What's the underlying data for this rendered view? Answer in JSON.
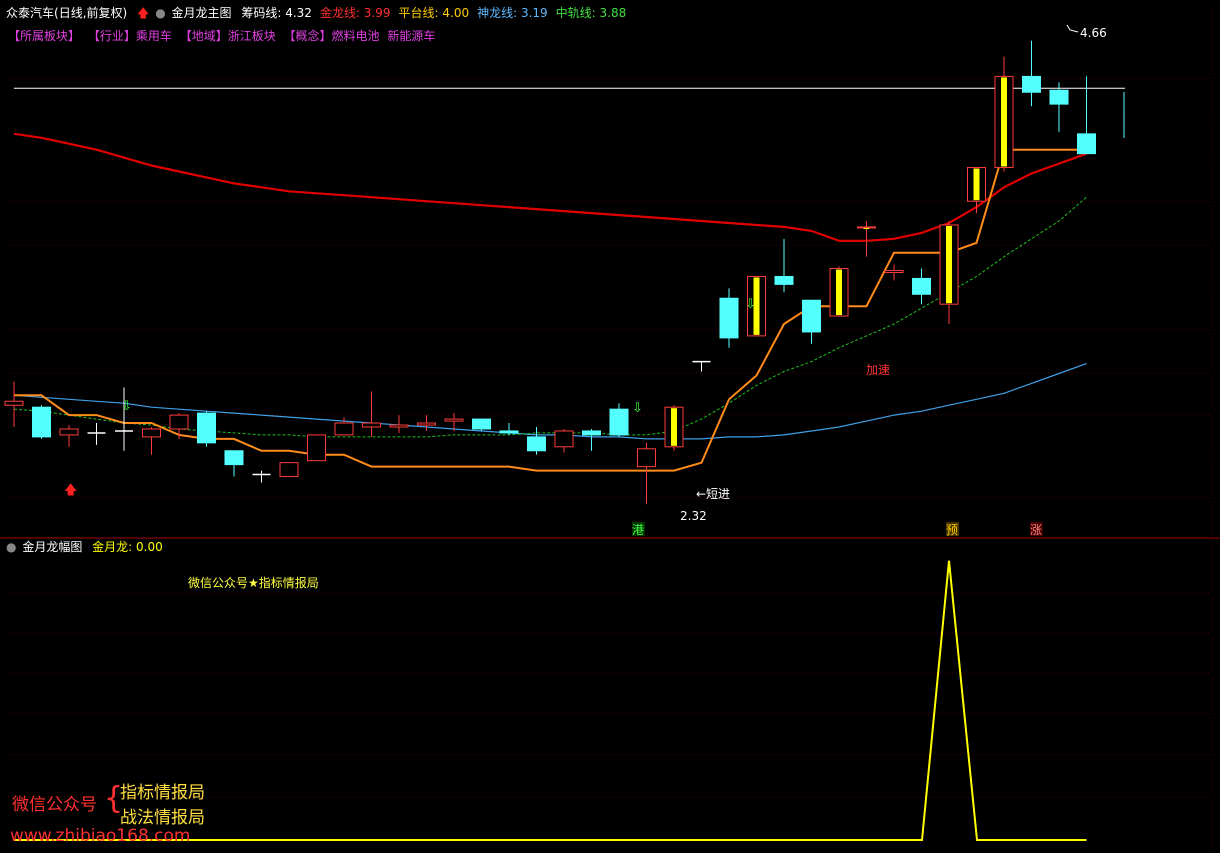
{
  "header": {
    "stock": "众泰汽车",
    "period": "(日线,前复权)",
    "indicator": "金月龙主图",
    "values": [
      {
        "label": "筹码线:",
        "value": "4.32",
        "color": "#ffffff"
      },
      {
        "label": "金龙线:",
        "value": "3.99",
        "color": "#ff3030"
      },
      {
        "label": "平台线:",
        "value": "4.00",
        "color": "#ffcc00"
      },
      {
        "label": "神龙线:",
        "value": "3.19",
        "color": "#5fb8ff"
      },
      {
        "label": "中轨线:",
        "value": "3.88",
        "color": "#40e040"
      }
    ]
  },
  "boards": [
    "【所属板块】",
    "【行业】乘用车",
    "【地域】浙江板块",
    "【概念】燃料电池",
    "新能源车"
  ],
  "lower_header": {
    "title": "金月龙幅图",
    "label": "金月龙:",
    "value": "0.00"
  },
  "watermark": {
    "top_text": "微信公众号★指标情报局",
    "left": "微信公众号",
    "line1": "指标情报局",
    "line2": "战法情报局",
    "url": "www.zhibiao168.com"
  },
  "annotations": {
    "high": "4.66",
    "low": "2.32",
    "entry": "←短进",
    "accel": "加速",
    "tag_gang": "港",
    "tag_yu": "预",
    "tag_zhang": "涨"
  },
  "colors": {
    "up": "#ff3c3c",
    "down": "#54ffff",
    "gold": "#ffff00",
    "ma_red": "#e00000",
    "platform": "#ff8c1a",
    "blue": "#3fa0e8",
    "mid": "#20c020"
  },
  "chart_data": {
    "type": "candlestick",
    "price_range": [
      2.2,
      4.8
    ],
    "candles": [
      {
        "o": 2.83,
        "h": 2.95,
        "l": 2.72,
        "c": 2.85,
        "t": "u"
      },
      {
        "o": 2.82,
        "h": 2.83,
        "l": 2.66,
        "c": 2.67,
        "t": "d"
      },
      {
        "o": 2.68,
        "h": 2.73,
        "l": 2.62,
        "c": 2.71,
        "t": "u"
      },
      {
        "o": 2.69,
        "h": 2.74,
        "l": 2.63,
        "c": 2.69,
        "t": "n"
      },
      {
        "o": 2.69,
        "h": 2.92,
        "l": 2.6,
        "c": 2.7,
        "t": "n"
      },
      {
        "o": 2.67,
        "h": 2.72,
        "l": 2.58,
        "c": 2.71,
        "t": "u"
      },
      {
        "o": 2.71,
        "h": 2.79,
        "l": 2.66,
        "c": 2.78,
        "t": "u"
      },
      {
        "o": 2.79,
        "h": 2.8,
        "l": 2.62,
        "c": 2.64,
        "t": "d"
      },
      {
        "o": 2.6,
        "h": 2.6,
        "l": 2.47,
        "c": 2.53,
        "t": "d"
      },
      {
        "o": 2.48,
        "h": 2.5,
        "l": 2.44,
        "c": 2.48,
        "t": "n"
      },
      {
        "o": 2.47,
        "h": 2.54,
        "l": 2.47,
        "c": 2.54,
        "t": "u"
      },
      {
        "o": 2.55,
        "h": 2.68,
        "l": 2.55,
        "c": 2.68,
        "t": "u"
      },
      {
        "o": 2.68,
        "h": 2.77,
        "l": 2.68,
        "c": 2.74,
        "t": "u"
      },
      {
        "o": 2.72,
        "h": 2.9,
        "l": 2.67,
        "c": 2.74,
        "t": "u"
      },
      {
        "o": 2.72,
        "h": 2.78,
        "l": 2.69,
        "c": 2.73,
        "t": "u"
      },
      {
        "o": 2.73,
        "h": 2.78,
        "l": 2.7,
        "c": 2.74,
        "t": "u"
      },
      {
        "o": 2.75,
        "h": 2.79,
        "l": 2.7,
        "c": 2.76,
        "t": "u"
      },
      {
        "o": 2.76,
        "h": 2.76,
        "l": 2.7,
        "c": 2.71,
        "t": "d"
      },
      {
        "o": 2.7,
        "h": 2.74,
        "l": 2.68,
        "c": 2.69,
        "t": "d"
      },
      {
        "o": 2.67,
        "h": 2.72,
        "l": 2.58,
        "c": 2.6,
        "t": "d"
      },
      {
        "o": 2.62,
        "h": 2.71,
        "l": 2.59,
        "c": 2.7,
        "t": "u"
      },
      {
        "o": 2.7,
        "h": 2.71,
        "l": 2.6,
        "c": 2.68,
        "t": "d"
      },
      {
        "o": 2.81,
        "h": 2.84,
        "l": 2.67,
        "c": 2.68,
        "t": "d"
      },
      {
        "o": 2.52,
        "h": 2.64,
        "l": 2.33,
        "c": 2.61,
        "t": "u"
      },
      {
        "o": 2.62,
        "h": 2.83,
        "l": 2.6,
        "c": 2.82,
        "t": "g"
      },
      {
        "o": 3.05,
        "h": 3.05,
        "l": 3.0,
        "c": 3.05,
        "t": "n"
      },
      {
        "o": 3.37,
        "h": 3.42,
        "l": 3.12,
        "c": 3.17,
        "t": "d"
      },
      {
        "o": 3.18,
        "h": 3.48,
        "l": 3.18,
        "c": 3.48,
        "t": "g"
      },
      {
        "o": 3.48,
        "h": 3.67,
        "l": 3.4,
        "c": 3.44,
        "t": "d"
      },
      {
        "o": 3.36,
        "h": 3.36,
        "l": 3.14,
        "c": 3.2,
        "t": "d"
      },
      {
        "o": 3.28,
        "h": 3.53,
        "l": 3.28,
        "c": 3.52,
        "t": "g"
      },
      {
        "o": 3.73,
        "h": 3.76,
        "l": 3.58,
        "c": 3.73,
        "t": "g"
      },
      {
        "o": 3.51,
        "h": 3.54,
        "l": 3.46,
        "c": 3.5,
        "t": "u"
      },
      {
        "o": 3.47,
        "h": 3.52,
        "l": 3.34,
        "c": 3.39,
        "t": "d"
      },
      {
        "o": 3.34,
        "h": 3.76,
        "l": 3.24,
        "c": 3.74,
        "t": "g"
      },
      {
        "o": 3.86,
        "h": 4.0,
        "l": 3.8,
        "c": 4.03,
        "t": "g"
      },
      {
        "o": 4.03,
        "h": 4.59,
        "l": 4.01,
        "c": 4.49,
        "t": "g"
      },
      {
        "o": 4.49,
        "h": 4.67,
        "l": 4.34,
        "c": 4.41,
        "t": "d"
      },
      {
        "o": 4.42,
        "h": 4.46,
        "l": 4.21,
        "c": 4.35,
        "t": "d"
      },
      {
        "o": 4.2,
        "h": 4.49,
        "l": 4.12,
        "c": 4.1,
        "t": "d"
      }
    ],
    "white_line": 4.43,
    "gold_line": [
      2.88,
      2.88,
      2.78,
      2.78,
      2.74,
      2.74,
      2.68,
      2.66,
      2.66,
      2.6,
      2.6,
      2.58,
      2.58,
      2.52,
      2.52,
      2.52,
      2.52,
      2.52,
      2.52,
      2.5,
      2.5,
      2.5,
      2.5,
      2.5,
      2.5,
      2.54,
      2.86,
      2.98,
      3.24,
      3.33,
      3.33,
      3.33,
      3.6,
      3.6,
      3.6,
      3.65,
      4.12,
      4.12,
      4.12,
      4.12
    ],
    "red_ma": [
      4.2,
      4.18,
      4.15,
      4.12,
      4.08,
      4.04,
      4.01,
      3.98,
      3.95,
      3.93,
      3.91,
      3.9,
      3.89,
      3.88,
      3.87,
      3.86,
      3.85,
      3.84,
      3.83,
      3.82,
      3.81,
      3.8,
      3.79,
      3.78,
      3.77,
      3.76,
      3.75,
      3.74,
      3.73,
      3.71,
      3.66,
      3.66,
      3.67,
      3.7,
      3.75,
      3.83,
      3.93,
      4.0,
      4.05,
      4.1
    ],
    "blue_line": [
      2.88,
      2.87,
      2.86,
      2.85,
      2.84,
      2.82,
      2.81,
      2.8,
      2.79,
      2.78,
      2.77,
      2.76,
      2.75,
      2.74,
      2.73,
      2.72,
      2.71,
      2.7,
      2.69,
      2.68,
      2.68,
      2.67,
      2.67,
      2.66,
      2.66,
      2.66,
      2.67,
      2.67,
      2.68,
      2.7,
      2.72,
      2.75,
      2.78,
      2.8,
      2.83,
      2.86,
      2.89,
      2.94,
      2.99,
      3.04
    ],
    "green_line": [
      2.81,
      2.8,
      2.78,
      2.76,
      2.74,
      2.73,
      2.71,
      2.7,
      2.69,
      2.68,
      2.68,
      2.67,
      2.67,
      2.67,
      2.67,
      2.67,
      2.68,
      2.68,
      2.68,
      2.69,
      2.69,
      2.69,
      2.68,
      2.68,
      2.7,
      2.76,
      2.84,
      2.93,
      3.0,
      3.05,
      3.12,
      3.18,
      3.24,
      3.32,
      3.4,
      3.48,
      3.58,
      3.67,
      3.76,
      3.88
    ],
    "lower": {
      "range": [
        0,
        1.0
      ],
      "values": [
        0,
        0,
        0,
        0,
        0,
        0,
        0,
        0,
        0,
        0,
        0,
        0,
        0,
        0,
        0,
        0,
        0,
        0,
        0,
        0,
        0,
        0,
        0,
        0,
        0,
        0,
        0,
        0,
        0,
        0,
        0,
        0,
        0,
        0,
        0.95,
        0,
        0,
        0,
        0,
        0
      ]
    }
  }
}
